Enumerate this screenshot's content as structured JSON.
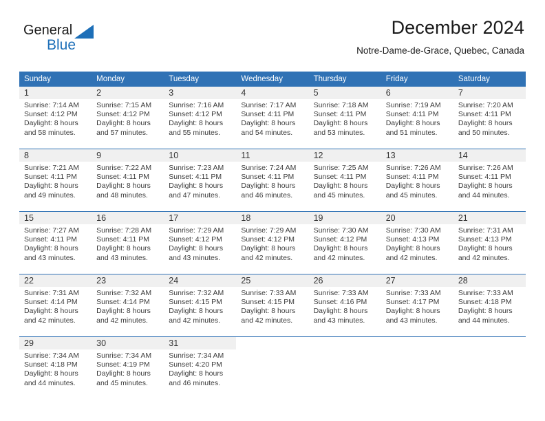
{
  "brand": {
    "name_primary": "General",
    "name_secondary": "Blue",
    "primary_color": "#1a1a1a",
    "accent_color": "#1d6fb8"
  },
  "header": {
    "title": "December 2024",
    "location": "Notre-Dame-de-Grace, Quebec, Canada"
  },
  "theme": {
    "header_bg": "#3072b5",
    "header_text": "#ffffff",
    "daynum_bg": "#f0f0f0",
    "grid_line": "#3072b5",
    "body_text": "#3b3b3b"
  },
  "weekday_headers": [
    "Sunday",
    "Monday",
    "Tuesday",
    "Wednesday",
    "Thursday",
    "Friday",
    "Saturday"
  ],
  "weeks": [
    [
      {
        "day": "1",
        "sunrise": "Sunrise: 7:14 AM",
        "sunset": "Sunset: 4:12 PM",
        "daylight_1": "Daylight: 8 hours",
        "daylight_2": "and 58 minutes."
      },
      {
        "day": "2",
        "sunrise": "Sunrise: 7:15 AM",
        "sunset": "Sunset: 4:12 PM",
        "daylight_1": "Daylight: 8 hours",
        "daylight_2": "and 57 minutes."
      },
      {
        "day": "3",
        "sunrise": "Sunrise: 7:16 AM",
        "sunset": "Sunset: 4:12 PM",
        "daylight_1": "Daylight: 8 hours",
        "daylight_2": "and 55 minutes."
      },
      {
        "day": "4",
        "sunrise": "Sunrise: 7:17 AM",
        "sunset": "Sunset: 4:11 PM",
        "daylight_1": "Daylight: 8 hours",
        "daylight_2": "and 54 minutes."
      },
      {
        "day": "5",
        "sunrise": "Sunrise: 7:18 AM",
        "sunset": "Sunset: 4:11 PM",
        "daylight_1": "Daylight: 8 hours",
        "daylight_2": "and 53 minutes."
      },
      {
        "day": "6",
        "sunrise": "Sunrise: 7:19 AM",
        "sunset": "Sunset: 4:11 PM",
        "daylight_1": "Daylight: 8 hours",
        "daylight_2": "and 51 minutes."
      },
      {
        "day": "7",
        "sunrise": "Sunrise: 7:20 AM",
        "sunset": "Sunset: 4:11 PM",
        "daylight_1": "Daylight: 8 hours",
        "daylight_2": "and 50 minutes."
      }
    ],
    [
      {
        "day": "8",
        "sunrise": "Sunrise: 7:21 AM",
        "sunset": "Sunset: 4:11 PM",
        "daylight_1": "Daylight: 8 hours",
        "daylight_2": "and 49 minutes."
      },
      {
        "day": "9",
        "sunrise": "Sunrise: 7:22 AM",
        "sunset": "Sunset: 4:11 PM",
        "daylight_1": "Daylight: 8 hours",
        "daylight_2": "and 48 minutes."
      },
      {
        "day": "10",
        "sunrise": "Sunrise: 7:23 AM",
        "sunset": "Sunset: 4:11 PM",
        "daylight_1": "Daylight: 8 hours",
        "daylight_2": "and 47 minutes."
      },
      {
        "day": "11",
        "sunrise": "Sunrise: 7:24 AM",
        "sunset": "Sunset: 4:11 PM",
        "daylight_1": "Daylight: 8 hours",
        "daylight_2": "and 46 minutes."
      },
      {
        "day": "12",
        "sunrise": "Sunrise: 7:25 AM",
        "sunset": "Sunset: 4:11 PM",
        "daylight_1": "Daylight: 8 hours",
        "daylight_2": "and 45 minutes."
      },
      {
        "day": "13",
        "sunrise": "Sunrise: 7:26 AM",
        "sunset": "Sunset: 4:11 PM",
        "daylight_1": "Daylight: 8 hours",
        "daylight_2": "and 45 minutes."
      },
      {
        "day": "14",
        "sunrise": "Sunrise: 7:26 AM",
        "sunset": "Sunset: 4:11 PM",
        "daylight_1": "Daylight: 8 hours",
        "daylight_2": "and 44 minutes."
      }
    ],
    [
      {
        "day": "15",
        "sunrise": "Sunrise: 7:27 AM",
        "sunset": "Sunset: 4:11 PM",
        "daylight_1": "Daylight: 8 hours",
        "daylight_2": "and 43 minutes."
      },
      {
        "day": "16",
        "sunrise": "Sunrise: 7:28 AM",
        "sunset": "Sunset: 4:11 PM",
        "daylight_1": "Daylight: 8 hours",
        "daylight_2": "and 43 minutes."
      },
      {
        "day": "17",
        "sunrise": "Sunrise: 7:29 AM",
        "sunset": "Sunset: 4:12 PM",
        "daylight_1": "Daylight: 8 hours",
        "daylight_2": "and 43 minutes."
      },
      {
        "day": "18",
        "sunrise": "Sunrise: 7:29 AM",
        "sunset": "Sunset: 4:12 PM",
        "daylight_1": "Daylight: 8 hours",
        "daylight_2": "and 42 minutes."
      },
      {
        "day": "19",
        "sunrise": "Sunrise: 7:30 AM",
        "sunset": "Sunset: 4:12 PM",
        "daylight_1": "Daylight: 8 hours",
        "daylight_2": "and 42 minutes."
      },
      {
        "day": "20",
        "sunrise": "Sunrise: 7:30 AM",
        "sunset": "Sunset: 4:13 PM",
        "daylight_1": "Daylight: 8 hours",
        "daylight_2": "and 42 minutes."
      },
      {
        "day": "21",
        "sunrise": "Sunrise: 7:31 AM",
        "sunset": "Sunset: 4:13 PM",
        "daylight_1": "Daylight: 8 hours",
        "daylight_2": "and 42 minutes."
      }
    ],
    [
      {
        "day": "22",
        "sunrise": "Sunrise: 7:31 AM",
        "sunset": "Sunset: 4:14 PM",
        "daylight_1": "Daylight: 8 hours",
        "daylight_2": "and 42 minutes."
      },
      {
        "day": "23",
        "sunrise": "Sunrise: 7:32 AM",
        "sunset": "Sunset: 4:14 PM",
        "daylight_1": "Daylight: 8 hours",
        "daylight_2": "and 42 minutes."
      },
      {
        "day": "24",
        "sunrise": "Sunrise: 7:32 AM",
        "sunset": "Sunset: 4:15 PM",
        "daylight_1": "Daylight: 8 hours",
        "daylight_2": "and 42 minutes."
      },
      {
        "day": "25",
        "sunrise": "Sunrise: 7:33 AM",
        "sunset": "Sunset: 4:15 PM",
        "daylight_1": "Daylight: 8 hours",
        "daylight_2": "and 42 minutes."
      },
      {
        "day": "26",
        "sunrise": "Sunrise: 7:33 AM",
        "sunset": "Sunset: 4:16 PM",
        "daylight_1": "Daylight: 8 hours",
        "daylight_2": "and 43 minutes."
      },
      {
        "day": "27",
        "sunrise": "Sunrise: 7:33 AM",
        "sunset": "Sunset: 4:17 PM",
        "daylight_1": "Daylight: 8 hours",
        "daylight_2": "and 43 minutes."
      },
      {
        "day": "28",
        "sunrise": "Sunrise: 7:33 AM",
        "sunset": "Sunset: 4:18 PM",
        "daylight_1": "Daylight: 8 hours",
        "daylight_2": "and 44 minutes."
      }
    ],
    [
      {
        "day": "29",
        "sunrise": "Sunrise: 7:34 AM",
        "sunset": "Sunset: 4:18 PM",
        "daylight_1": "Daylight: 8 hours",
        "daylight_2": "and 44 minutes."
      },
      {
        "day": "30",
        "sunrise": "Sunrise: 7:34 AM",
        "sunset": "Sunset: 4:19 PM",
        "daylight_1": "Daylight: 8 hours",
        "daylight_2": "and 45 minutes."
      },
      {
        "day": "31",
        "sunrise": "Sunrise: 7:34 AM",
        "sunset": "Sunset: 4:20 PM",
        "daylight_1": "Daylight: 8 hours",
        "daylight_2": "and 46 minutes."
      },
      {
        "day": "",
        "sunrise": "",
        "sunset": "",
        "daylight_1": "",
        "daylight_2": ""
      },
      {
        "day": "",
        "sunrise": "",
        "sunset": "",
        "daylight_1": "",
        "daylight_2": ""
      },
      {
        "day": "",
        "sunrise": "",
        "sunset": "",
        "daylight_1": "",
        "daylight_2": ""
      },
      {
        "day": "",
        "sunrise": "",
        "sunset": "",
        "daylight_1": "",
        "daylight_2": ""
      }
    ]
  ]
}
